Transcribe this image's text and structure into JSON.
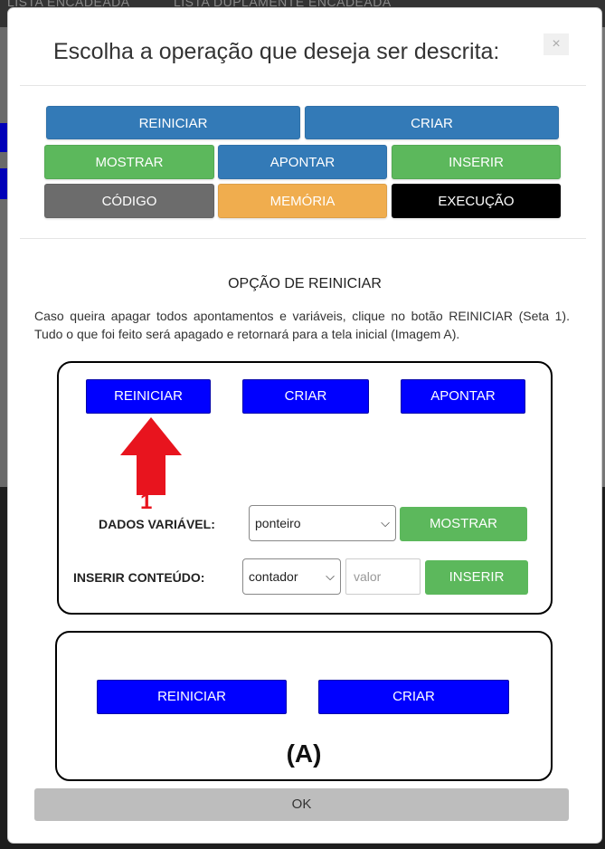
{
  "background": {
    "nav_left": "LISTA ENCADEADA",
    "nav_right": "LISTA DUPLAMENTE ENCADEADA"
  },
  "modal": {
    "title": "Escolha a operação que deseja ser descrita:",
    "close": "×"
  },
  "operations": {
    "reiniciar": "REINICIAR",
    "criar": "CRIAR",
    "mostrar": "MOSTRAR",
    "apontar": "APONTAR",
    "inserir": "INSERIR",
    "codigo": "CÓDIGO",
    "memoria": "MEMÓRIA",
    "execucao": "EXECUÇÃO"
  },
  "section": {
    "title": "OPÇÃO DE REINICIAR",
    "description": "Caso queira apagar todos apontamentos e variáveis, clique no botão REINICIAR (Seta 1). Tudo o que foi feito será apagado e retornará para a tela inicial (Imagem A)."
  },
  "demo1": {
    "reiniciar": "REINICIAR",
    "criar": "CRIAR",
    "apontar": "APONTAR",
    "arrow_number": "1",
    "dados_label": "DADOS VARIÁVEL:",
    "dados_select": "ponteiro",
    "mostrar": "MOSTRAR",
    "inserir_label": "INSERIR CONTEÚDO:",
    "inserir_select": "contador",
    "valor_placeholder": "valor",
    "inserir": "INSERIR"
  },
  "demo2": {
    "reiniciar": "REINICIAR",
    "criar": "CRIAR",
    "caption": "(A)"
  },
  "footer": {
    "ok": "OK"
  },
  "colors": {
    "primary": "#337ab7",
    "success": "#5cb85c",
    "warning": "#f0ad4e",
    "demo_blue": "#0000ff",
    "arrow_red": "#e8141e"
  }
}
